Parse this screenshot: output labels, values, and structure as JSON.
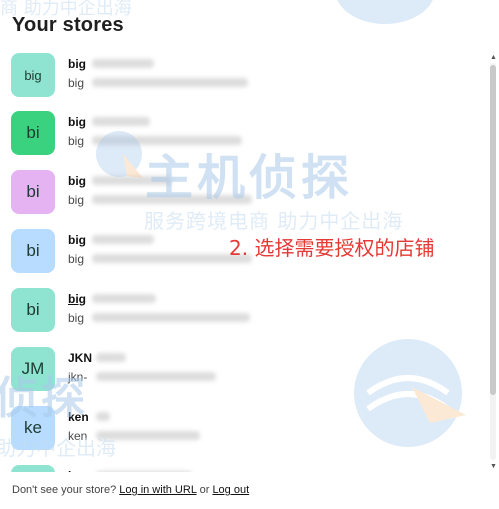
{
  "title": "Your stores",
  "stores": [
    {
      "avatar": "big",
      "avatar_bg": "#8fe3d1",
      "name": "big",
      "domain": "big"
    },
    {
      "avatar": "bi",
      "avatar_bg": "#3ad27f",
      "name": "big",
      "domain": "big"
    },
    {
      "avatar": "bi",
      "avatar_bg": "#e6b3f2",
      "name": "big",
      "domain": "big"
    },
    {
      "avatar": "bi",
      "avatar_bg": "#b7dcff",
      "name": "big",
      "domain": "big"
    },
    {
      "avatar": "bi",
      "avatar_bg": "#8fe3d1",
      "name": "big",
      "domain": "big"
    },
    {
      "avatar": "JM",
      "avatar_bg": "#8fe3d1",
      "name": "JKN",
      "domain": "jkn-"
    },
    {
      "avatar": "ke",
      "avatar_bg": "#b7dcff",
      "name": "ken",
      "domain": "ken"
    },
    {
      "avatar": "",
      "avatar_bg": "#8fe3d1",
      "name": "lwg",
      "domain": ""
    }
  ],
  "footer": {
    "prompt": "Don't see your store?",
    "login_url_label": "Log in with URL",
    "or_label": "or",
    "logout_label": "Log out"
  },
  "annotation": "2. 选择需要授权的店铺",
  "watermark": {
    "top_left": "商  助力中企出海",
    "center_main": "主机侦探",
    "center_sub": "服务跨境电商  助力中企出海",
    "bottom_left_main": "侦探",
    "bottom_left_sub": "助力中企出海"
  },
  "colors": {
    "annotation": "#e53935",
    "watermark": "#c5dcef"
  }
}
